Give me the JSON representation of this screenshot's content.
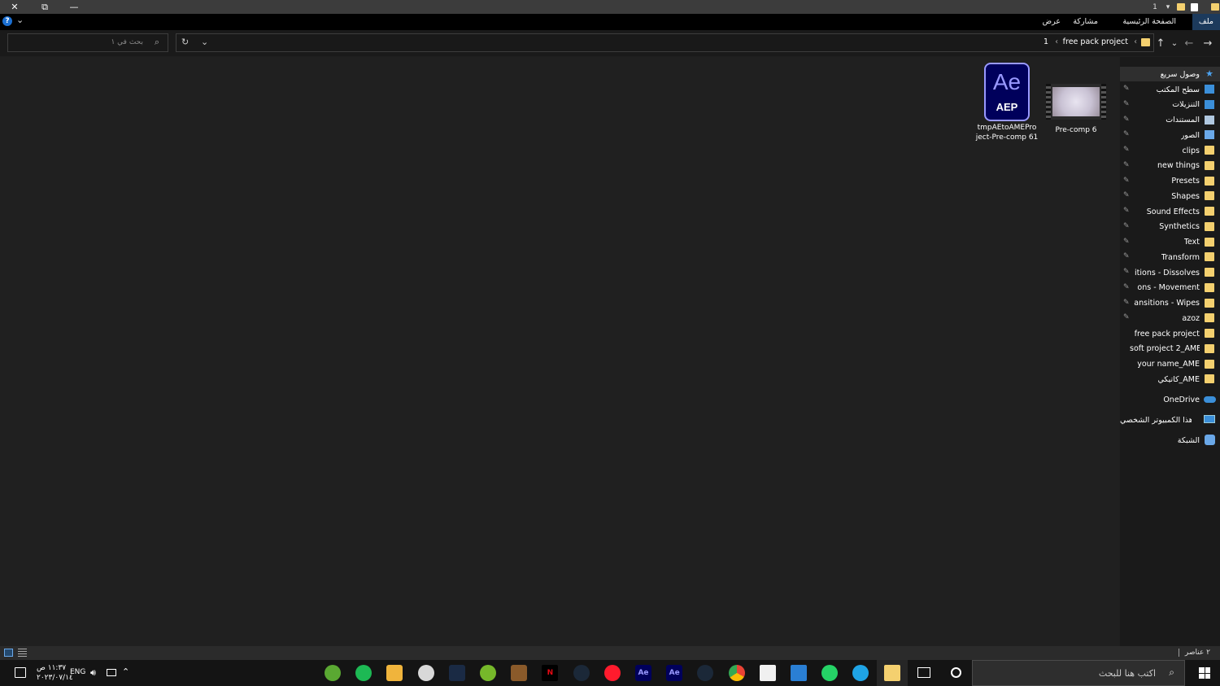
{
  "titlebar": {
    "close_glyph": "✕",
    "restore_glyph": "⧉",
    "minimize_glyph": "—",
    "quick_access_number": "1",
    "dropdown_glyph": "▾"
  },
  "ribbon": {
    "tabs": [
      {
        "label": "ملف",
        "active": true
      },
      {
        "label": "الصفحة الرئيسية",
        "active": false
      },
      {
        "label": "مشاركة",
        "active": false
      },
      {
        "label": "عرض",
        "active": false
      }
    ],
    "help_glyph": "?",
    "expand_glyph": "⌄"
  },
  "address": {
    "back_glyph": "→",
    "forward_glyph": "←",
    "recent_glyph": "⌄",
    "up_glyph": "↑",
    "crumb_sep": "‹",
    "crumb_folder": "free pack project",
    "crumb_item": "1",
    "dropdown_glyph": "⌄",
    "refresh_glyph": "↻",
    "search_placeholder": "بحث في ١",
    "search_glyph": "⌕"
  },
  "navpane": {
    "quick_access": "وصول سريع",
    "items": [
      {
        "label": "سطح المكتب",
        "icon": "desktop-icon",
        "pinned": true
      },
      {
        "label": "التنزيلات",
        "icon": "download-icon",
        "pinned": true
      },
      {
        "label": "المستندات",
        "icon": "documents-icon",
        "pinned": true
      },
      {
        "label": "الصور",
        "icon": "pictures-icon",
        "pinned": true
      },
      {
        "label": "clips",
        "icon": "folder-icon",
        "pinned": true
      },
      {
        "label": "new things",
        "icon": "folder-icon",
        "pinned": true
      },
      {
        "label": "Presets",
        "icon": "folder-icon",
        "pinned": true
      },
      {
        "label": "Shapes",
        "icon": "folder-icon",
        "pinned": true
      },
      {
        "label": "Sound Effects",
        "icon": "folder-icon",
        "pinned": true
      },
      {
        "label": "Synthetics",
        "icon": "folder-icon",
        "pinned": true
      },
      {
        "label": "Text",
        "icon": "folder-icon",
        "pinned": true
      },
      {
        "label": "Transform",
        "icon": "folder-icon",
        "pinned": true
      },
      {
        "label": "itions - Dissolves",
        "icon": "folder-icon",
        "pinned": true
      },
      {
        "label": "ons - Movement",
        "icon": "folder-icon",
        "pinned": true
      },
      {
        "label": "ansitions - Wipes",
        "icon": "folder-icon",
        "pinned": true
      },
      {
        "label": "azoz",
        "icon": "folder-icon",
        "pinned": true
      },
      {
        "label": "free pack project",
        "icon": "folder-icon",
        "pinned": false
      },
      {
        "label": "soft project 2_AME",
        "icon": "folder-icon",
        "pinned": false
      },
      {
        "label": "your name_AME",
        "icon": "folder-icon",
        "pinned": false
      },
      {
        "label": "كاتيكي_AME",
        "icon": "folder-icon",
        "pinned": false
      }
    ],
    "onedrive": "OneDrive",
    "this_pc": "هذا الكمبيوتر الشخصي",
    "network": "الشبكة",
    "pin_glyph": "📌"
  },
  "files": [
    {
      "name_line1": "Pre-comp 6",
      "name_line2": "",
      "icon": "video-thumbnail-icon"
    },
    {
      "name_line1": "tmpAEtoAMEPro",
      "name_line2": "ject-Pre-comp 61",
      "icon": "aep-file-icon",
      "badge_big": "Ae",
      "badge_small": "AEP"
    }
  ],
  "statusbar": {
    "item_count": "٢ عناصر"
  },
  "taskbar": {
    "search_placeholder": "اكتب هنا للبحث",
    "lang": "ENG",
    "time": "١١:٣٧ ص",
    "date": "٢٠٢٣/٠٧/١٤",
    "apps": [
      "utorrent-icon",
      "spotify-icon",
      "files-icon",
      "steelseries-icon",
      "editor-icon",
      "utorrent-green-icon",
      "game-icon",
      "netflix-icon",
      "steam-icon",
      "opera-icon",
      "after-effects-icon",
      "after-effects-2-icon",
      "steam-2-icon",
      "chrome-icon",
      "store-icon",
      "mail-icon",
      "whatsapp-icon",
      "edge-icon",
      "file-explorer-icon"
    ]
  },
  "colors": {
    "folder": "#f4d06f",
    "ae_purple": "#9999ff",
    "ae_bg": "#00005b",
    "accent_blue": "#1c3a5c"
  }
}
